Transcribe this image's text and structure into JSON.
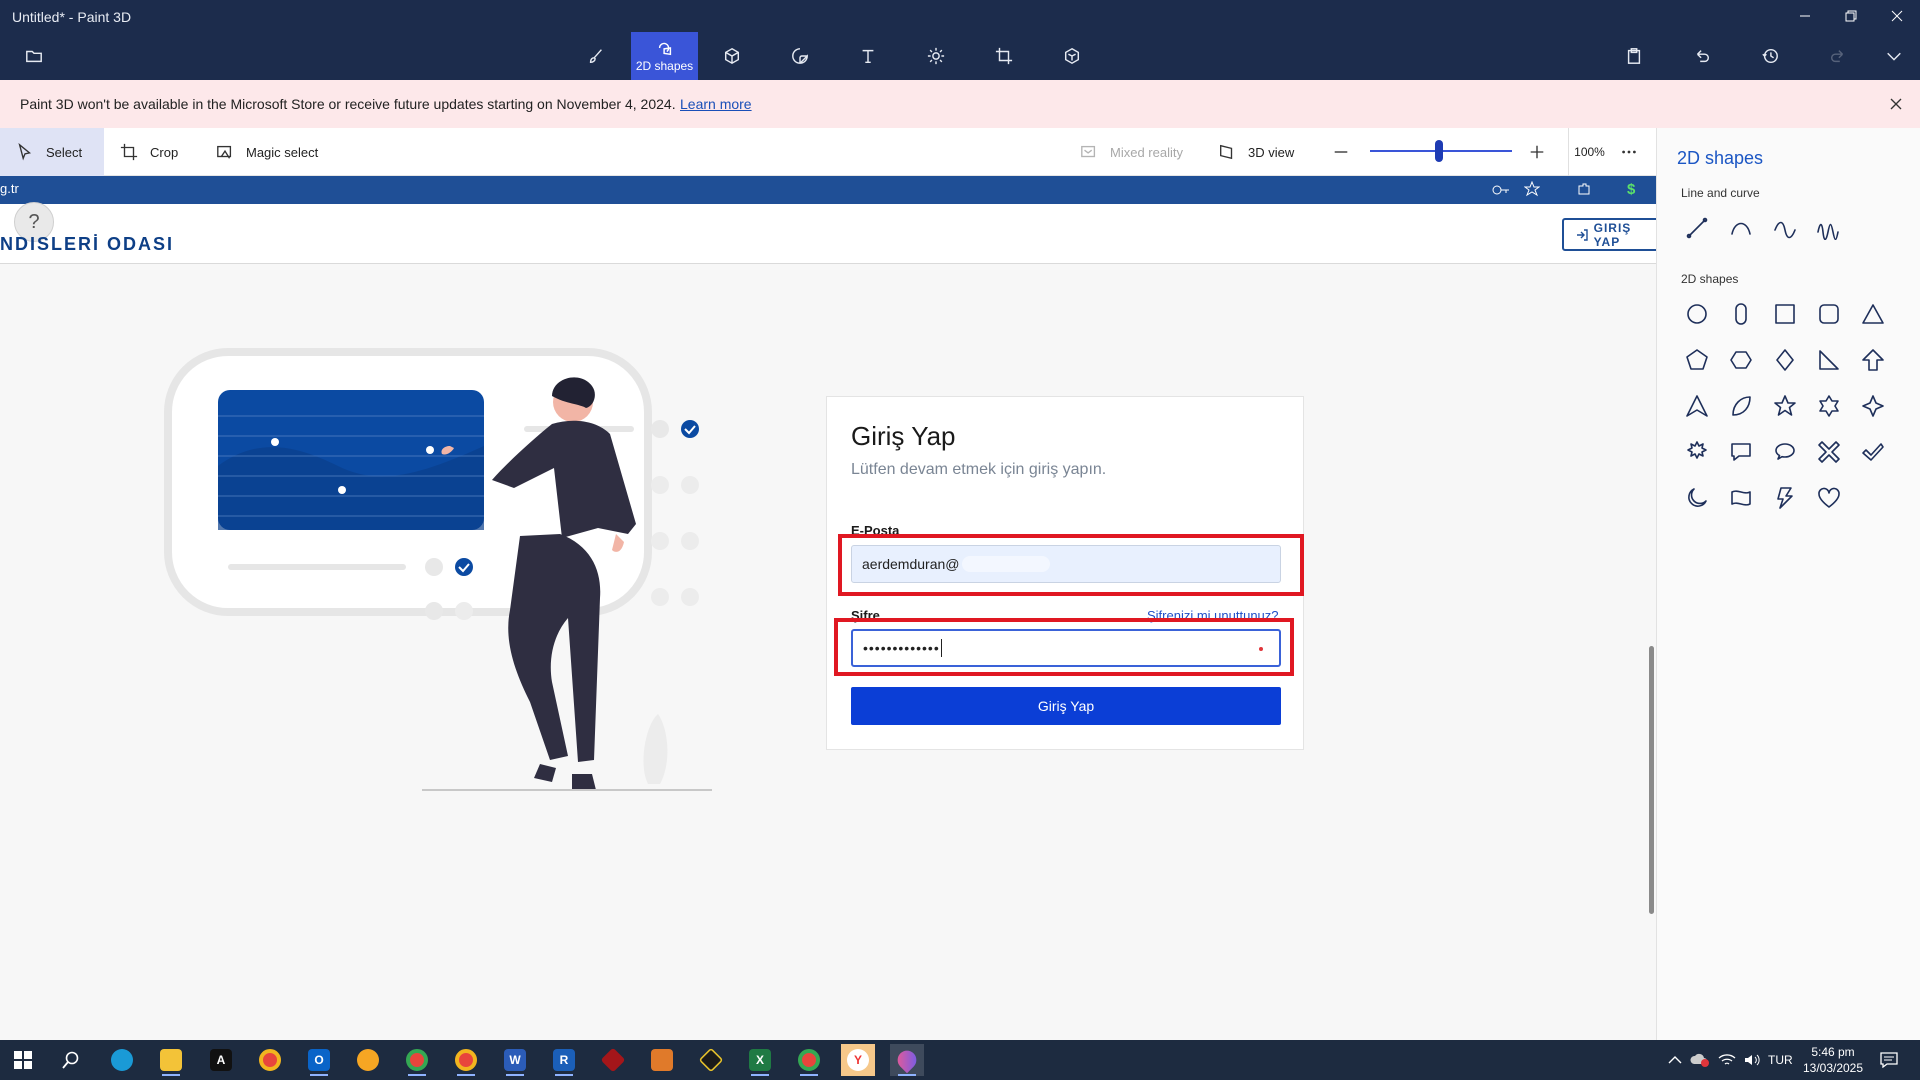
{
  "window": {
    "title": "Untitled* - Paint 3D"
  },
  "toolbar": {
    "active_tab_label": "2D shapes"
  },
  "banner": {
    "text": "Paint 3D won't be available in the Microsoft Store or receive future updates starting on November 4, 2024.",
    "link": "Learn more"
  },
  "subtoolbar": {
    "select": "Select",
    "crop": "Crop",
    "magic_select": "Magic select",
    "mixed_reality": "Mixed reality",
    "view_3d": "3D view",
    "zoom": "100%"
  },
  "canvas": {
    "url_fragment": "g.tr",
    "help": "?",
    "header_title": "NDISLERİ ODASI",
    "header_login": "GIRIŞ YAP",
    "card": {
      "title": "Giriş Yap",
      "subtitle": "Lütfen devam etmek için giriş yapın.",
      "email_label": "E-Posta",
      "email_value": "aerdemduran@",
      "password_label": "Şifre",
      "forgot": "Şifrenizi mi unuttunuz?",
      "password_value": "•••••••••••••",
      "submit": "Giriş Yap"
    }
  },
  "panel": {
    "title": "2D shapes",
    "line_section": "Line and curve",
    "shapes_section": "2D shapes"
  },
  "taskbar": {
    "lang": "TUR",
    "time": "5:46 pm",
    "date": "13/03/2025"
  },
  "colors": {
    "titlebar": "#1c2c4c",
    "accent": "#3a55d8",
    "highlight_box": "#e01822",
    "submit_button": "#0b3ed6"
  }
}
